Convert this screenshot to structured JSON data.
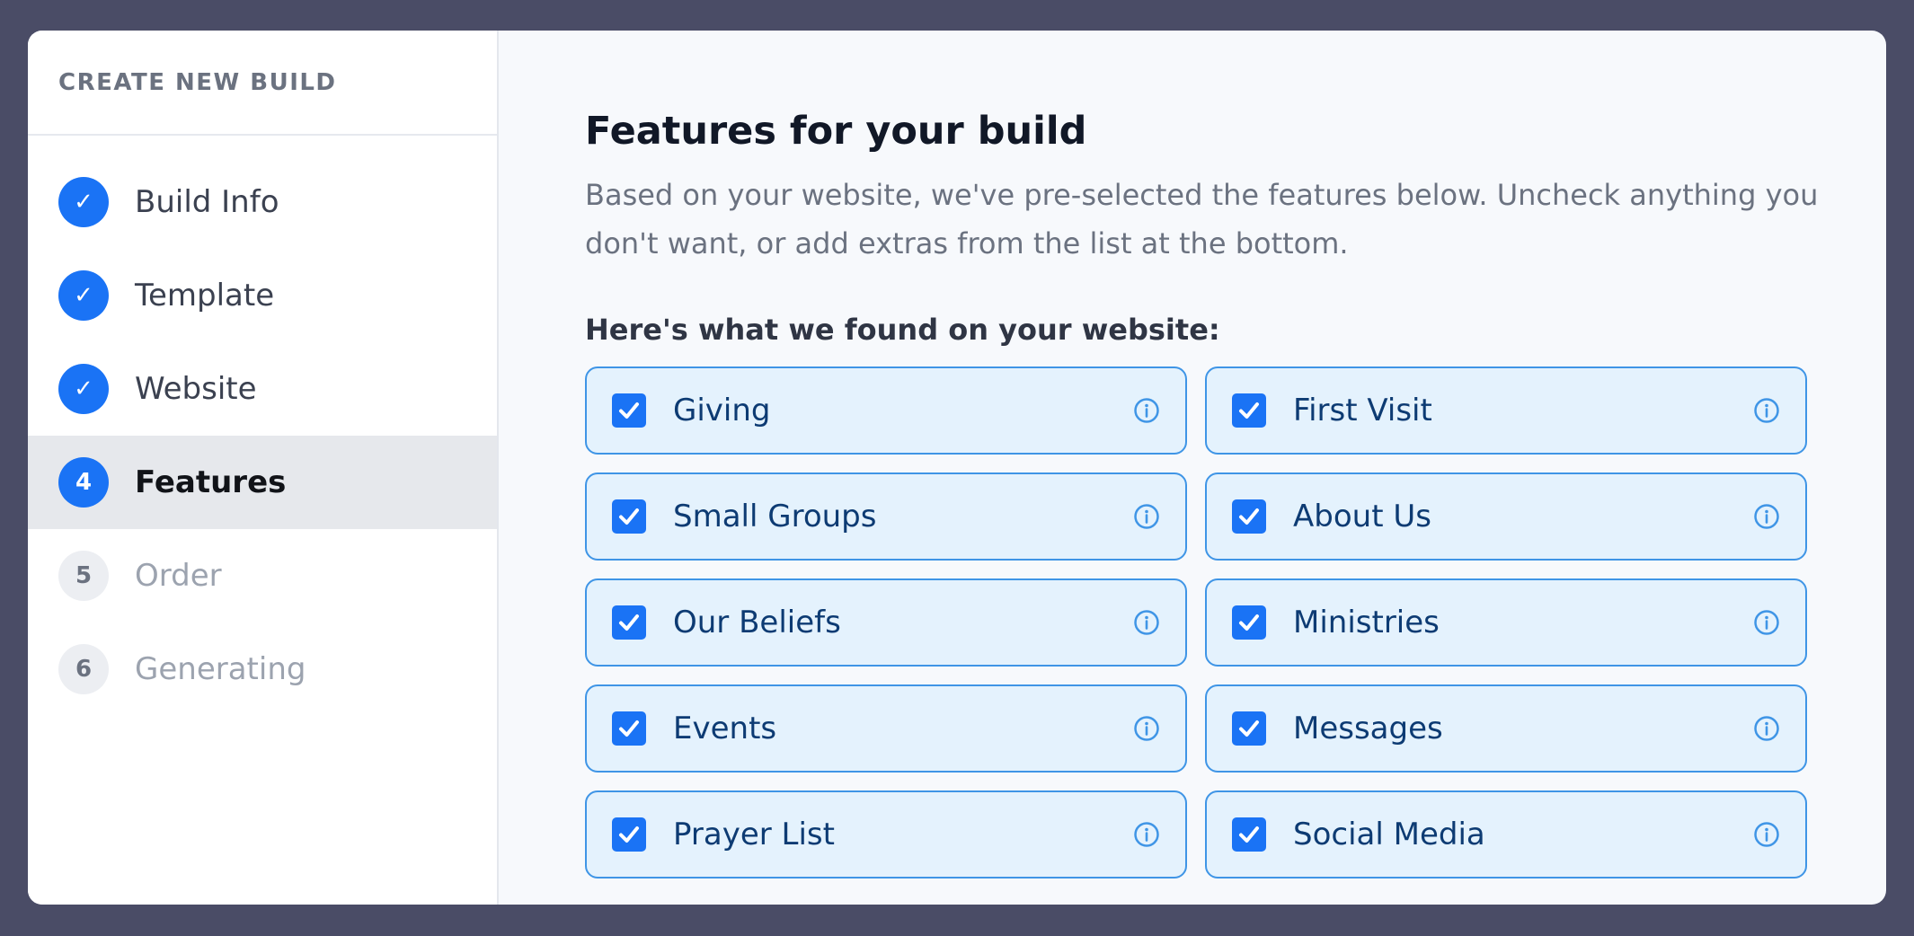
{
  "sidebar": {
    "title": "CREATE NEW BUILD",
    "steps": [
      {
        "marker": "✓",
        "label": "Build Info",
        "state": "done"
      },
      {
        "marker": "✓",
        "label": "Template",
        "state": "done"
      },
      {
        "marker": "✓",
        "label": "Website",
        "state": "done"
      },
      {
        "marker": "4",
        "label": "Features",
        "state": "current"
      },
      {
        "marker": "5",
        "label": "Order",
        "state": "pending"
      },
      {
        "marker": "6",
        "label": "Generating",
        "state": "pending"
      }
    ]
  },
  "main": {
    "title": "Features for your build",
    "description": "Based on your website, we've pre-selected the features below. Uncheck anything you don't want, or add extras from the list at the bottom.",
    "section_label": "Here's what we found on your website:",
    "features": [
      {
        "label": "Giving",
        "checked": true
      },
      {
        "label": "First Visit",
        "checked": true
      },
      {
        "label": "Small Groups",
        "checked": true
      },
      {
        "label": "About Us",
        "checked": true
      },
      {
        "label": "Our Beliefs",
        "checked": true
      },
      {
        "label": "Ministries",
        "checked": true
      },
      {
        "label": "Events",
        "checked": true
      },
      {
        "label": "Messages",
        "checked": true
      },
      {
        "label": "Prayer List",
        "checked": true
      },
      {
        "label": "Social Media",
        "checked": true
      }
    ]
  },
  "colors": {
    "accent": "#1a73f5",
    "card_border": "#3f95e6",
    "card_bg": "#e4f2fd",
    "frame": "#4a4c66"
  }
}
